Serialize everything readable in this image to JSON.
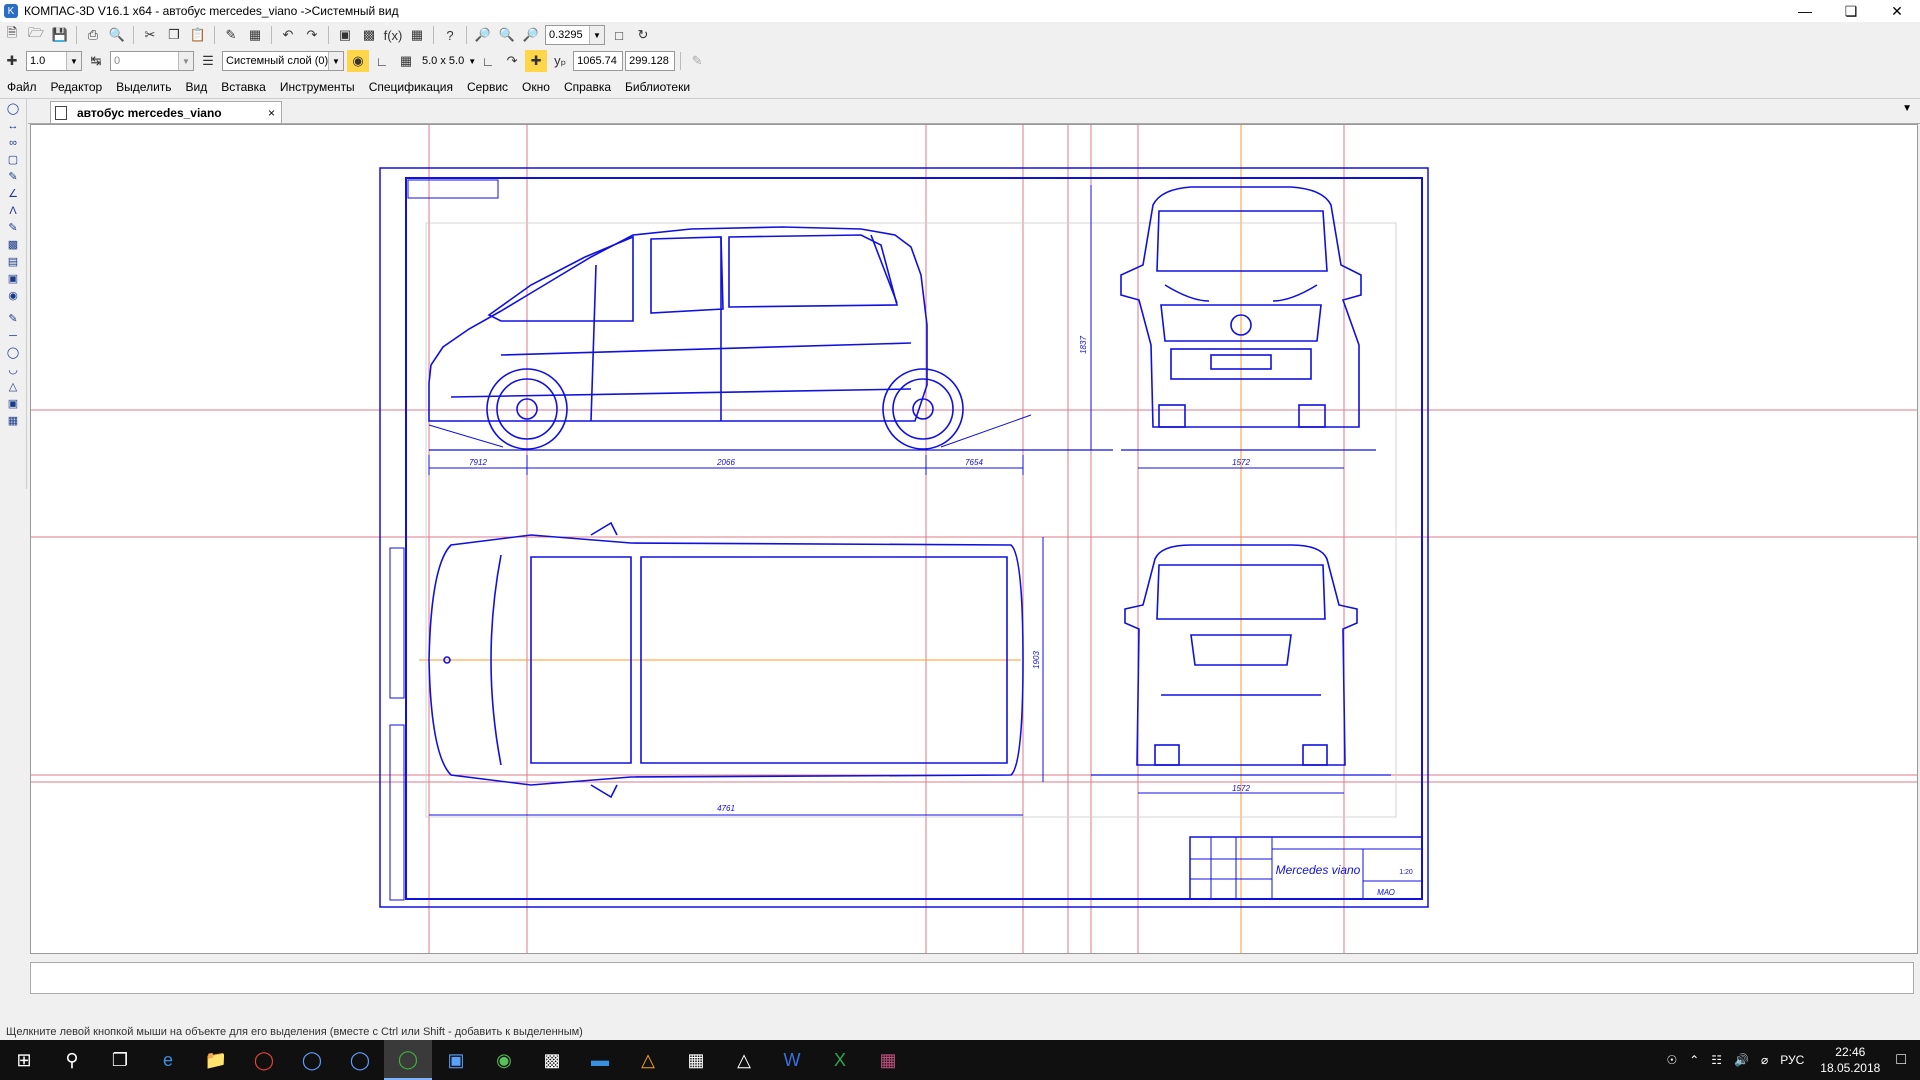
{
  "window": {
    "title": "КОМПАС-3D V16.1 x64 - автобус mercedes_viano ->Системный вид",
    "controls": [
      "minimize",
      "maximize",
      "close"
    ]
  },
  "toolbar1": {
    "zoom_value": "0.3295"
  },
  "toolbar2": {
    "scale_value": "1.0",
    "style_value": "0",
    "layer_value": "Системный слой (0)",
    "grid_value": "5.0 x 5.0",
    "coord_x": "1065.74",
    "coord_y": "299.128"
  },
  "menu": {
    "items": [
      "Файл",
      "Редактор",
      "Выделить",
      "Вид",
      "Вставка",
      "Инструменты",
      "Спецификация",
      "Сервис",
      "Окно",
      "Справка",
      "Библиотеки"
    ]
  },
  "document_tab": {
    "label": "автобус mercedes_viano",
    "close": "×"
  },
  "drawing": {
    "dims": {
      "front_overhang": "7912",
      "wheelbase": "2066",
      "rear_overhang": "7654",
      "height": "1837",
      "front_track": "1572",
      "length": "4761",
      "width": "1903",
      "rear_track": "1572"
    },
    "title_block": {
      "name": "Mercedes viano",
      "scale": "1:20",
      "org": "МАО"
    }
  },
  "status": {
    "hint": "Щелкните левой кнопкой мыши на объекте для его выделения (вместе с Ctrl или Shift - добавить к выделенным)"
  },
  "taskbar": {
    "apps": [
      "windows-start",
      "search",
      "task-view",
      "edge",
      "explorer",
      "chrome",
      "kompas-1",
      "kompas-2",
      "xbox",
      "calculator-app",
      "app-green",
      "charts-app",
      "stack-app",
      "triangle-app",
      "calculator",
      "photos",
      "word",
      "excel",
      "rar"
    ],
    "tray": {
      "lang": "РУС",
      "time": "22:46",
      "date": "18.05.2018"
    }
  }
}
